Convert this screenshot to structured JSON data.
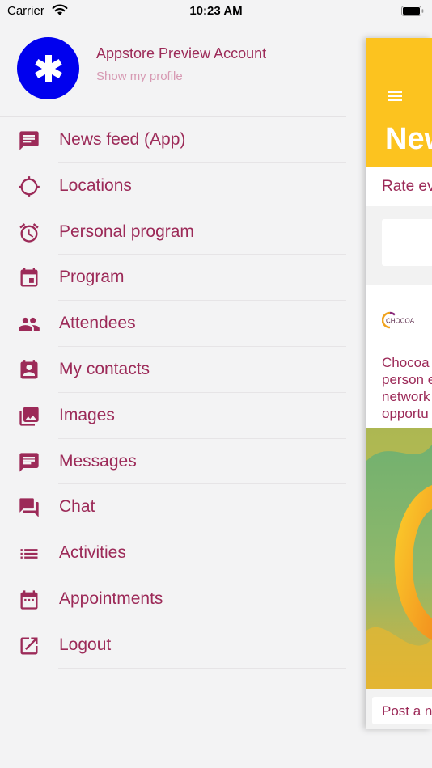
{
  "status_bar": {
    "carrier": "Carrier",
    "time": "10:23 AM"
  },
  "profile": {
    "name": "Appstore Preview Account",
    "link": "Show my profile"
  },
  "menu": [
    {
      "label": "News feed (App)",
      "icon": "news-feed-icon"
    },
    {
      "label": "Locations",
      "icon": "crosshair-icon"
    },
    {
      "label": "Personal program",
      "icon": "alarm-clock-icon"
    },
    {
      "label": "Program",
      "icon": "calendar-icon"
    },
    {
      "label": "Attendees",
      "icon": "people-icon"
    },
    {
      "label": "My contacts",
      "icon": "contact-card-icon"
    },
    {
      "label": "Images",
      "icon": "images-icon"
    },
    {
      "label": "Messages",
      "icon": "message-icon"
    },
    {
      "label": "Chat",
      "icon": "chat-icon"
    },
    {
      "label": "Activities",
      "icon": "list-icon"
    },
    {
      "label": "Appointments",
      "icon": "calendar-grid-icon"
    },
    {
      "label": "Logout",
      "icon": "logout-icon"
    }
  ],
  "background_screen": {
    "title": "New",
    "rate_text": "Rate ev",
    "post_logo": "CHOCOA",
    "post_lines": [
      "Chocoa",
      "person e",
      "network",
      "opportu"
    ],
    "post_button": "Post a n"
  },
  "colors": {
    "accent": "#9c2a58",
    "header": "#fcc31f",
    "avatar": "#0000ee"
  }
}
